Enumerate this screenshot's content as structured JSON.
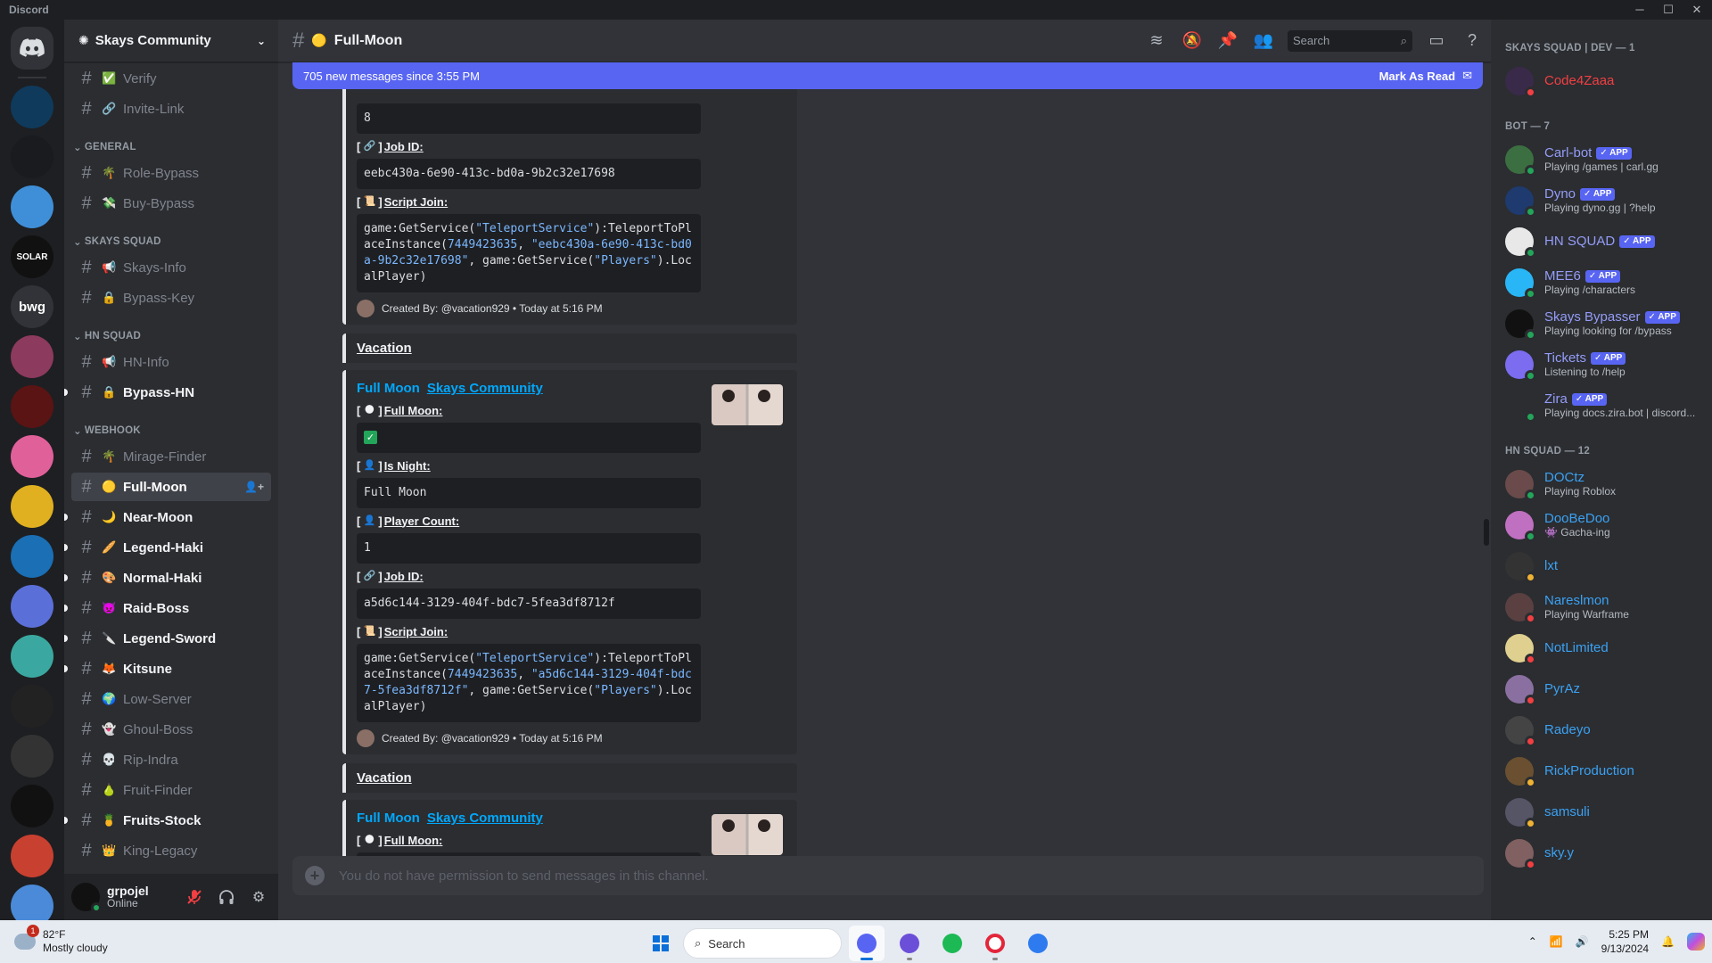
{
  "app": {
    "title": "Discord"
  },
  "guilds": [
    {
      "name": "CIT",
      "color": "#0f3a5c"
    },
    {
      "name": "controller",
      "color": "#1a1b1e"
    },
    {
      "name": "blue",
      "color": "#3f8fd8"
    },
    {
      "name": "SOLAR",
      "color": "#111111"
    },
    {
      "name": "bwg",
      "color": "#313338"
    },
    {
      "name": "anime",
      "color": "#8c3a5e"
    },
    {
      "name": "ETERNAL",
      "color": "#5a1414"
    },
    {
      "name": "kuromi",
      "color": "#e0609a"
    },
    {
      "name": "yellow",
      "color": "#e0b020"
    },
    {
      "name": "drop",
      "color": "#1a6fb5"
    },
    {
      "name": "anime2",
      "color": "#5a6fd8"
    },
    {
      "name": "teal",
      "color": "#3aa8a0"
    },
    {
      "name": "dark",
      "color": "#222222"
    },
    {
      "name": "solara",
      "color": "#333333"
    },
    {
      "name": "swirl",
      "color": "#111111"
    },
    {
      "name": "red",
      "color": "#c84030"
    },
    {
      "name": "anime3",
      "color": "#4a8ad8"
    }
  ],
  "server": {
    "name": "Skays Community"
  },
  "channels": {
    "top": [
      {
        "name": "Verify",
        "emoji": "✅"
      },
      {
        "name": "Invite-Link",
        "emoji": "🔗"
      }
    ],
    "categories": [
      {
        "title": "GENERAL",
        "items": [
          {
            "name": "Role-Bypass",
            "emoji": "🌴",
            "unread": false
          },
          {
            "name": "Buy-Bypass",
            "emoji": "💸",
            "unread": false
          }
        ]
      },
      {
        "title": "SKAYS SQUAD",
        "items": [
          {
            "name": "Skays-Info",
            "emoji": "📢",
            "unread": false
          },
          {
            "name": "Bypass-Key",
            "emoji": "🔒",
            "unread": false
          }
        ]
      },
      {
        "title": "HN SQUAD",
        "items": [
          {
            "name": "HN-Info",
            "emoji": "📢",
            "unread": false
          },
          {
            "name": "Bypass-HN",
            "emoji": "🔒",
            "unread": true
          }
        ]
      },
      {
        "title": "WEBHOOK",
        "items": [
          {
            "name": "Mirage-Finder",
            "emoji": "🌴",
            "unread": false
          },
          {
            "name": "Full-Moon",
            "emoji": "🟡",
            "unread": true,
            "active": true
          },
          {
            "name": "Near-Moon",
            "emoji": "🌙",
            "unread": true
          },
          {
            "name": "Legend-Haki",
            "emoji": "🥖",
            "unread": true
          },
          {
            "name": "Normal-Haki",
            "emoji": "🎨",
            "unread": true
          },
          {
            "name": "Raid-Boss",
            "emoji": "👿",
            "unread": true
          },
          {
            "name": "Legend-Sword",
            "emoji": "🔪",
            "unread": true
          },
          {
            "name": "Kitsune",
            "emoji": "🦊",
            "unread": true
          },
          {
            "name": "Low-Server",
            "emoji": "🌍",
            "unread": false
          },
          {
            "name": "Ghoul-Boss",
            "emoji": "👻",
            "unread": false
          },
          {
            "name": "Rip-Indra",
            "emoji": "💀",
            "unread": false
          },
          {
            "name": "Fruit-Finder",
            "emoji": "🍐",
            "unread": false
          },
          {
            "name": "Fruits-Stock",
            "emoji": "🍍",
            "unread": true
          },
          {
            "name": "King-Legacy",
            "emoji": "👑",
            "unread": false
          }
        ]
      }
    ]
  },
  "user": {
    "name": "grpojel",
    "status": "Online"
  },
  "header": {
    "channel": "Full-Moon",
    "emoji": "🟡",
    "search_placeholder": "Search"
  },
  "newbar": {
    "text": "705 new messages since 3:55 PM",
    "action": "Mark As Read"
  },
  "partial_embed": {
    "top_value": "8",
    "job_label": "Job ID:",
    "job_id": "eebc430a-6e90-413c-bd0a-9b2c32e17698",
    "script_label": "Script Join:",
    "script_pre": "game:GetService(",
    "script_service": "\"TeleportService\"",
    "script_mid": "):TeleportToPlaceInstance(",
    "script_place": "7449423635",
    "script_sep": ", ",
    "script_job": "\"eebc430a-6e90-413c-bd0a-9b2c32e17698\"",
    "script_end": ", game:GetService(",
    "script_players": "\"Players\"",
    "script_tail": ").LocalPlayer)",
    "footer": "Created By: @vacation929 • Today at 5:16 PM"
  },
  "messages": [
    {
      "author": "Vacation",
      "embed_title": "Full Moon",
      "embed_author": "Skays Community",
      "full_moon_label": "Full Moon:",
      "is_night_label": "Is Night:",
      "is_night_value": "Full Moon",
      "player_count_label": "Player Count:",
      "player_count_value": "1",
      "job_label": "Job ID:",
      "job_id": "a5d6c144-3129-404f-bdc7-5fea3df8712f",
      "script_label": "Script Join:",
      "script_job": "\"a5d6c144-3129-404f-bdc7-5fea3df8712f\"",
      "footer": "Created By: @vacation929 • Today at 5:16 PM"
    },
    {
      "author": "Vacation",
      "embed_title": "Full Moon",
      "embed_author": "Skays Community",
      "full_moon_label": "Full Moon:"
    }
  ],
  "composer": {
    "placeholder": "You do not have permission to send messages in this channel."
  },
  "members": {
    "groups": [
      {
        "title": "SKAYS SQUAD | DEV — 1",
        "items": [
          {
            "name": "Code4Zaaa",
            "color": "#f23f42",
            "status": "dnd",
            "activity": "",
            "app": false,
            "avatar": "#3a2a4a"
          }
        ]
      },
      {
        "title": "BOT — 7",
        "items": [
          {
            "name": "Carl-bot",
            "color": "#949cf7",
            "status": "on",
            "activity": "Playing /games | carl.gg",
            "app": true,
            "avatar": "#3b6e40"
          },
          {
            "name": "Dyno",
            "color": "#949cf7",
            "status": "on",
            "activity": "Playing dyno.gg | ?help",
            "app": true,
            "avatar": "#1e3a6e"
          },
          {
            "name": "HN SQUAD",
            "color": "#949cf7",
            "status": "on",
            "activity": "",
            "app": true,
            "avatar": "#e8e8e8"
          },
          {
            "name": "MEE6",
            "color": "#949cf7",
            "status": "on",
            "activity": "Playing /characters",
            "app": true,
            "avatar": "#29b6f6"
          },
          {
            "name": "Skays Bypasser",
            "color": "#949cf7",
            "status": "on",
            "activity": "Playing looking for /bypass",
            "app": true,
            "avatar": "#111111"
          },
          {
            "name": "Tickets",
            "color": "#949cf7",
            "status": "on",
            "activity": "Listening to /help",
            "app": true,
            "avatar": "#7b6cf0"
          },
          {
            "name": "Zira",
            "color": "#949cf7",
            "status": "on",
            "activity": "Playing docs.zira.bot | discord...",
            "app": true,
            "avatar": "#2b2d31"
          }
        ]
      },
      {
        "title": "HN SQUAD — 12",
        "items": [
          {
            "name": "DOCtz",
            "color": "#3ba1f2",
            "status": "on",
            "activity": "Playing Roblox",
            "app": false,
            "avatar": "#6a4a4a"
          },
          {
            "name": "DooBeDoo",
            "color": "#3ba1f2",
            "status": "on",
            "activity": "👾 Gacha-ing",
            "app": false,
            "avatar": "#c070c0"
          },
          {
            "name": "lxt",
            "color": "#3ba1f2",
            "status": "idle",
            "activity": "",
            "app": false,
            "avatar": "#333333"
          },
          {
            "name": "Nareslmon",
            "color": "#3ba1f2",
            "status": "dnd",
            "activity": "Playing Warframe",
            "app": false,
            "avatar": "#5a4040"
          },
          {
            "name": "NotLimited",
            "color": "#3ba1f2",
            "status": "dnd",
            "activity": "",
            "app": false,
            "avatar": "#e0d090"
          },
          {
            "name": "PyrAz",
            "color": "#3ba1f2",
            "status": "dnd",
            "activity": "",
            "app": false,
            "avatar": "#8a70a0"
          },
          {
            "name": "Radeyo",
            "color": "#3ba1f2",
            "status": "dnd",
            "activity": "",
            "app": false,
            "avatar": "#444444"
          },
          {
            "name": "RickProduction",
            "color": "#3ba1f2",
            "status": "idle",
            "activity": "",
            "app": false,
            "avatar": "#6a5030"
          },
          {
            "name": "samsuli",
            "color": "#3ba1f2",
            "status": "idle",
            "activity": "",
            "app": false,
            "avatar": "#555566"
          },
          {
            "name": "sky.y",
            "color": "#3ba1f2",
            "status": "dnd",
            "activity": "",
            "app": false,
            "avatar": "#806060"
          }
        ]
      }
    ]
  },
  "taskbar": {
    "temp": "82°F",
    "weather": "Mostly cloudy",
    "weather_badge": "1",
    "search": "Search",
    "time": "5:25 PM",
    "date": "9/13/2024"
  }
}
